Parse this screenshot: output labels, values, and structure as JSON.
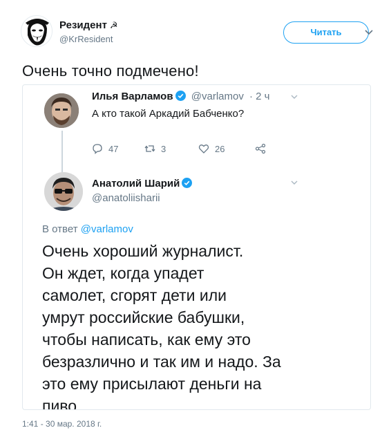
{
  "colors": {
    "accent": "#1da1f2",
    "text": "#14171a",
    "muted": "#657786",
    "border": "#e1e8ed"
  },
  "tweet": {
    "author_name": "Резидент",
    "author_symbol": "☭",
    "author_handle": "@KrResident",
    "follow_label": "Читать",
    "text": "Очень точно подмечено!",
    "timestamp": "1:41 - 30 мар. 2018 г."
  },
  "screenshot": {
    "first_tweet": {
      "author_name": "Илья Варламов",
      "author_handle": "@varlamov",
      "time": "· 2 ч",
      "text": "А кто такой Аркадий Бабченко?",
      "replies": "47",
      "retweets": "3",
      "likes": "26"
    },
    "reply_tweet": {
      "author_name": "Анатолий Шарий",
      "author_handle": "@anatoliisharii",
      "reply_prefix": "В ответ ",
      "reply_target": "@varlamov",
      "text_lines": [
        "Очень хороший журналист.",
        "Он ждет, когда упадет",
        "самолет, сгорят дети или",
        "умрут российские бабушки,",
        "чтобы написать, как ему это",
        "безразлично и так им и надо. За",
        "это ему присылают деньги на",
        "пиво."
      ]
    }
  },
  "icons": {
    "main_avatar": "guy-fawkes-mask-avatar",
    "verified": "verified-badge-icon",
    "reply": "reply-icon",
    "retweet": "retweet-icon",
    "like": "heart-icon",
    "share": "share-icon",
    "caret": "chevron-down-icon"
  }
}
